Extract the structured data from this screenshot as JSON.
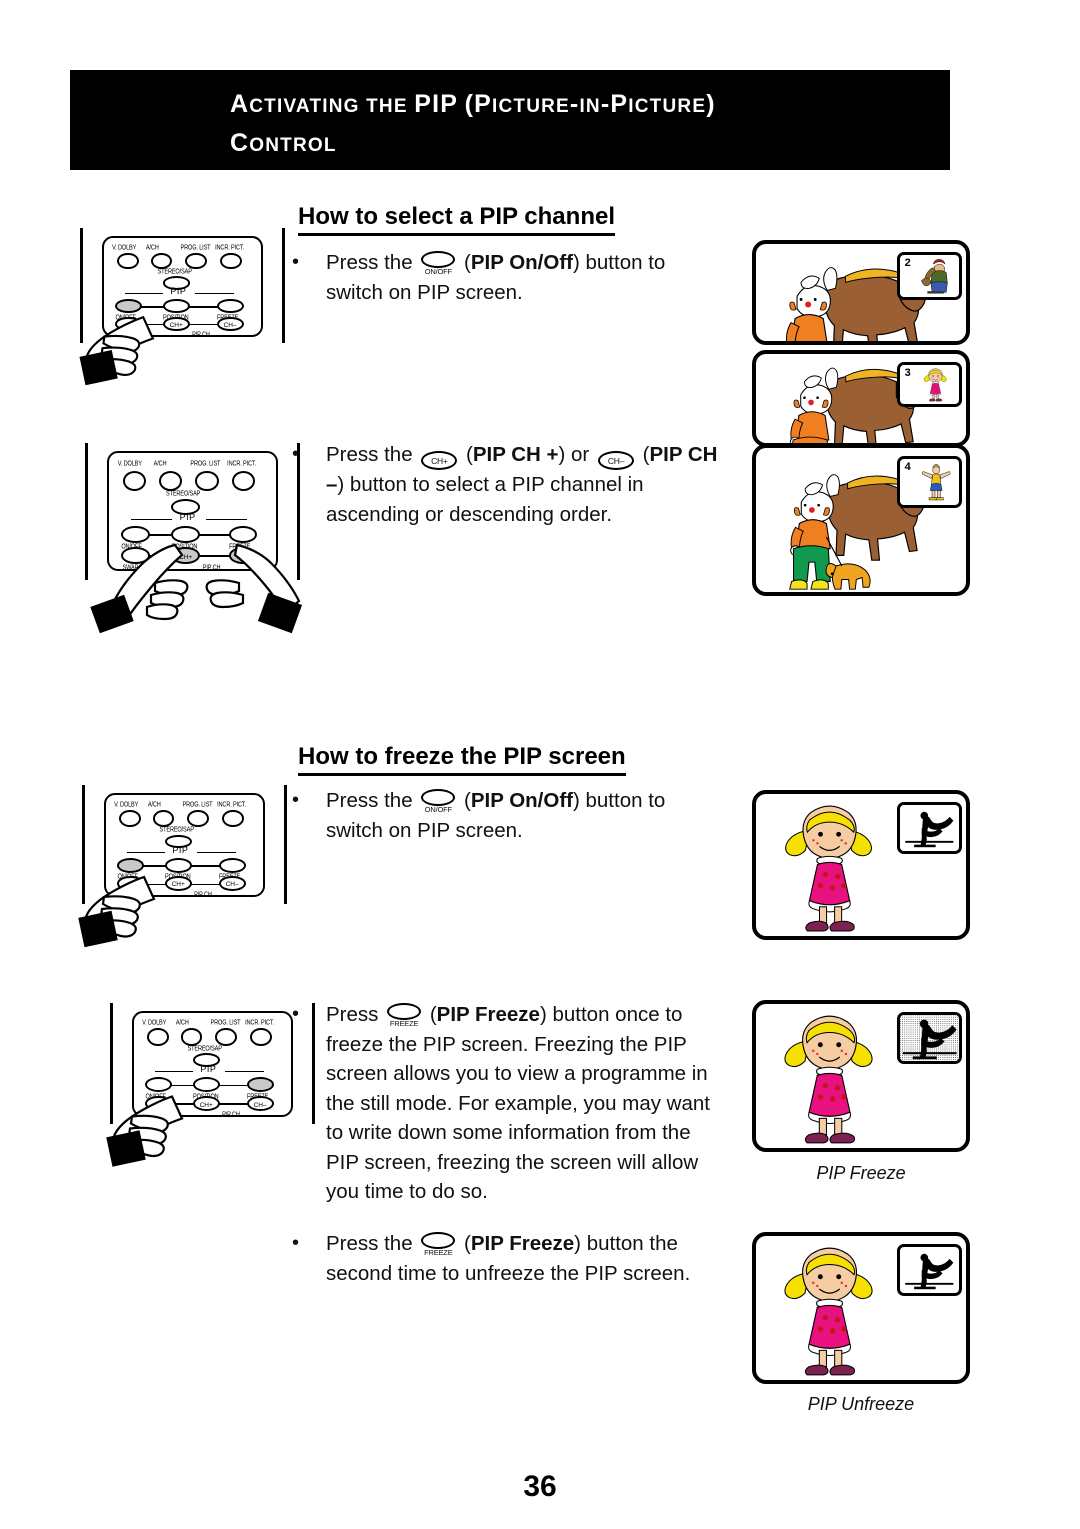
{
  "header": {
    "line1_parts": [
      "A",
      "CTIVATING THE ",
      "PIP",
      " (P",
      "ICTURE",
      "-",
      "IN",
      "-P",
      "ICTURE",
      ")"
    ],
    "line1_plain": "ACTIVATING THE PIP (PICTURE-IN-PICTURE)",
    "line2_plain": "CONTROL",
    "line2_cap": "C",
    "line2_rest": "ONTROL",
    "background": "#000000",
    "text_color": "#ffffff"
  },
  "sections": [
    {
      "heading": "How to select a PIP channel",
      "bullets": [
        {
          "pre": "Press the",
          "glyph": {
            "kind": "oval",
            "sub": "ON/OFF",
            "name": "pip-on-off-button-icon"
          },
          "mid_open": "(",
          "bold": "PIP On/Off",
          "post": ") button to switch on PIP screen."
        },
        {
          "pre": "Press the",
          "glyph": {
            "kind": "pill",
            "label": "CH+",
            "name": "pip-ch-plus-button-icon"
          },
          "bold": "PIP CH +",
          "post": "or",
          "glyph2": {
            "kind": "pill",
            "label": "CH–",
            "name": "pip-ch-minus-button-icon"
          },
          "bold2": "PIP CH –",
          "post2": ") button to select a PIP channel in ascending or descending order."
        }
      ]
    },
    {
      "heading": "How to freeze the PIP screen",
      "bullets": [
        {
          "pre": "Press the",
          "glyph": {
            "kind": "oval",
            "sub": "ON/OFF",
            "name": "pip-on-off-button-icon"
          },
          "bold": "PIP On/Off",
          "post": ") button to switch on PIP screen."
        },
        {
          "pre": "Press",
          "glyph": {
            "kind": "oval",
            "sub": "FREEZE",
            "name": "pip-freeze-button-icon"
          },
          "bold": "PIP Freeze",
          "post": ") button once to freeze the PIP screen. Freezing the PIP screen allows you to view a programme in the still mode. For example, you may want to write down some information from the PIP screen, freezing the screen will allow you time to do so."
        },
        {
          "pre": "Press the",
          "glyph": {
            "kind": "oval",
            "sub": "FREEZE",
            "name": "pip-freeze-button-icon"
          },
          "bold": "PIP Freeze",
          "post": ") button the second time to unfreeze the PIP screen."
        }
      ]
    }
  ],
  "remote": {
    "top_row_labels": [
      "V. DOLBY",
      "A/CH",
      "PROG. LIST",
      "INCR. PICT."
    ],
    "stereo_label": "STEREO/SAP",
    "pip_group_label": "PIP",
    "mid_row_labels": [
      "ON/OFF",
      "POSITION",
      "FREEZE"
    ],
    "bottom_row_labels": [
      "SWAP",
      "CH+",
      "CH–"
    ],
    "pip_ch_label": "PIP CH",
    "pressed_color": "#c9c9c9"
  },
  "remotes": [
    {
      "name": "remote-onoff-select",
      "pressed": [
        "ON/OFF"
      ],
      "hands": 1
    },
    {
      "name": "remote-ch-plus-minus",
      "pressed": [
        "CH+",
        "CH–"
      ],
      "hands": 2
    },
    {
      "name": "remote-onoff-freeze",
      "pressed": [
        "ON/OFF"
      ],
      "hands": 1
    },
    {
      "name": "remote-freeze",
      "pressed": [
        "FREEZE"
      ],
      "hands": 1
    }
  ],
  "tv_panels": [
    {
      "name": "tv-screen-channel-2",
      "main": "clown-and-horse",
      "pip_number": "2",
      "pip_content": "guitarist",
      "caption": ""
    },
    {
      "name": "tv-screen-channel-3",
      "main": "clown-and-horse",
      "pip_number": "3",
      "pip_content": "girl-in-pink",
      "caption": ""
    },
    {
      "name": "tv-screen-channel-4",
      "main": "clown-horse-and-dog",
      "pip_number": "4",
      "pip_content": "gymnast",
      "caption": ""
    },
    {
      "name": "tv-screen-pip-on",
      "main": "girl-with-pigtails",
      "pip_number": "",
      "pip_content": "skater-silhouette",
      "caption": ""
    },
    {
      "name": "tv-screen-pip-freeze",
      "main": "girl-with-pigtails",
      "pip_number": "",
      "pip_content": "skater-silhouette-frozen",
      "caption": "PIP Freeze"
    },
    {
      "name": "tv-screen-pip-unfreeze",
      "main": "girl-with-pigtails",
      "pip_number": "",
      "pip_content": "skater-silhouette",
      "caption": "PIP Unfreeze"
    }
  ],
  "footer": {
    "page_number": "36"
  },
  "colors": {
    "clown_shirt": "#f07f22",
    "clown_pants": "#0f9a4e",
    "clown_shoes": "#f2e31a",
    "horse_body": "#9a6033",
    "horse_mane": "#f0b323",
    "dog": "#f0a31e",
    "dress_pink": "#e8117f",
    "hair_blonde": "#f5e000",
    "skin": "#f6cda3",
    "shoes_purple": "#7a2250"
  }
}
